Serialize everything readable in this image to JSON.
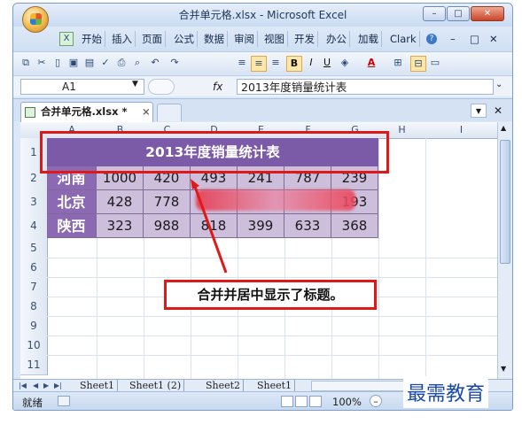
{
  "window": {
    "title": "合并单元格.xlsx - Microsoft Excel",
    "controls": [
      "–",
      "□",
      "✕"
    ]
  },
  "ribbon_tabs": [
    "开始",
    "插入",
    "页面",
    "公式",
    "数据",
    "审阅",
    "视图",
    "开发",
    "办公",
    "加载",
    "Clark"
  ],
  "ribbon_right": [
    "?",
    "–",
    "□",
    "✕"
  ],
  "toolbar": {
    "bold": "B",
    "italic": "I",
    "underline": "U",
    "font_color": "A"
  },
  "formula_bar": {
    "name_box": "A1",
    "fx": "fx",
    "content": "2013年度销量统计表"
  },
  "doc_tab": {
    "label": "合并单元格.xlsx *",
    "close": "×"
  },
  "columns": [
    "A",
    "B",
    "C",
    "D",
    "E",
    "F",
    "G",
    "H",
    "I"
  ],
  "rows": [
    "1",
    "2",
    "3",
    "4",
    "5",
    "6",
    "7",
    "8",
    "9",
    "10",
    "11"
  ],
  "table": {
    "title": "2013年度销量统计表",
    "data": [
      [
        "河南",
        "1000",
        "420",
        "493",
        "241",
        "787",
        "239"
      ],
      [
        "北京",
        "428",
        "778",
        "",
        "",
        "",
        "193"
      ],
      [
        "陕西",
        "323",
        "988",
        "818",
        "399",
        "633",
        "368"
      ]
    ]
  },
  "annotation": "合并并居中显示了标题。",
  "sheet_tabs": [
    "Sheet1",
    "Sheet1 (2)",
    "Sheet2",
    "Sheet1"
  ],
  "status": {
    "ready": "就绪",
    "zoom": "100%",
    "zoom_minus": "–"
  },
  "watermark": "最需教育",
  "colors": {
    "title_bg": "#7b5ba8",
    "name_bg": "#8c6ab3",
    "data_bg": "#cdbfdc",
    "highlight": "#e01818"
  }
}
